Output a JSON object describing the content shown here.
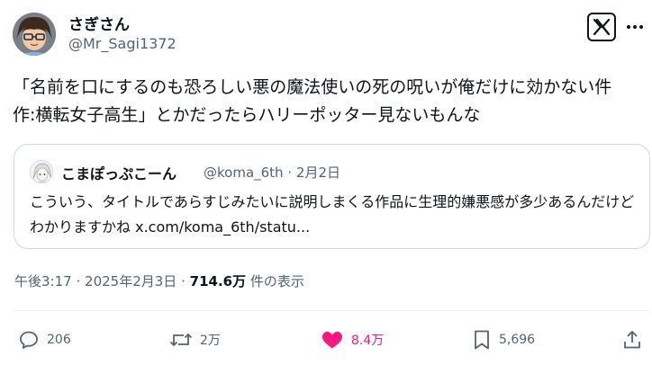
{
  "author": {
    "display_name": "さぎさん",
    "handle": "@Mr_Sagi1372"
  },
  "tweet": {
    "text": "「名前を口にするのも恐ろしい悪の魔法使いの死の呪いが俺だけに効かない件　作:横転女子高生」とかだったらハリーポッター見ないもんな"
  },
  "quote": {
    "display_name": "こまぽっぷこーん",
    "handle": "@koma_6th",
    "separator": "·",
    "date": "2月2日",
    "text": "こういう、タイトルであらすじみたいに説明しまくる作品に生理的嫌悪感が多少あるんだけどわかりますかね",
    "link": "x.com/koma_6th/statu..."
  },
  "meta": {
    "time": "午後3:17",
    "separator": "·",
    "date": "2025年2月3日",
    "separator2": "·",
    "views": "714.6万",
    "views_label": "件の表示"
  },
  "actions": {
    "replies": "206",
    "reposts": "2万",
    "likes": "8.4万",
    "bookmarks": "5,696"
  },
  "colors": {
    "text": "#0f1419",
    "secondary": "#536471",
    "like": "#f91880",
    "border": "#cfd9de"
  },
  "icons": [
    "avatar",
    "x-logo-icon",
    "more-icon",
    "reply-icon",
    "repost-icon",
    "like-icon",
    "bookmark-icon",
    "share-icon"
  ]
}
